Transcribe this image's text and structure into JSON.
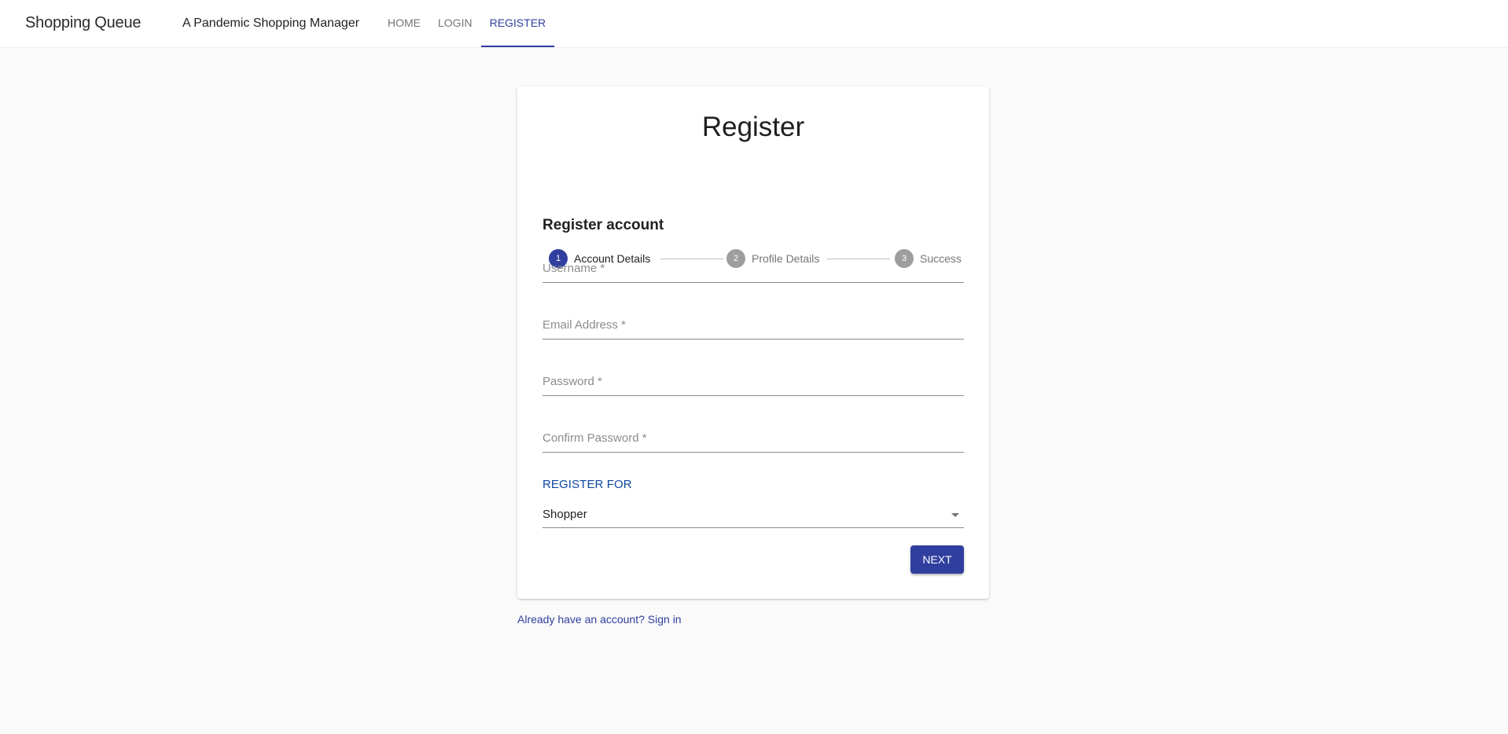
{
  "header": {
    "brand": "Shopping Queue",
    "tagline": "A Pandemic Shopping Manager",
    "nav": [
      {
        "label": "HOME",
        "active": false
      },
      {
        "label": "LOGIN",
        "active": false
      },
      {
        "label": "REGISTER",
        "active": true
      }
    ]
  },
  "card": {
    "title": "Register",
    "steps": [
      {
        "number": "1",
        "label": "Account Details",
        "active": true
      },
      {
        "number": "2",
        "label": "Profile Details",
        "active": false
      },
      {
        "number": "3",
        "label": "Success",
        "active": false
      }
    ],
    "section_title": "Register account",
    "fields": [
      {
        "placeholder": "Username *",
        "value": ""
      },
      {
        "placeholder": "Email Address *",
        "value": ""
      },
      {
        "placeholder": "Password *",
        "value": ""
      },
      {
        "placeholder": "Confirm Password *",
        "value": ""
      }
    ],
    "register_for": {
      "label": "REGISTER FOR",
      "selected": "Shopper"
    },
    "next_label": "NEXT"
  },
  "footer_link": "Already have an account? Sign in",
  "colors": {
    "primary": "#303f9f",
    "inactive_step": "#9e9e9e",
    "select_label": "#0d47a1",
    "background": "#fafafa"
  }
}
